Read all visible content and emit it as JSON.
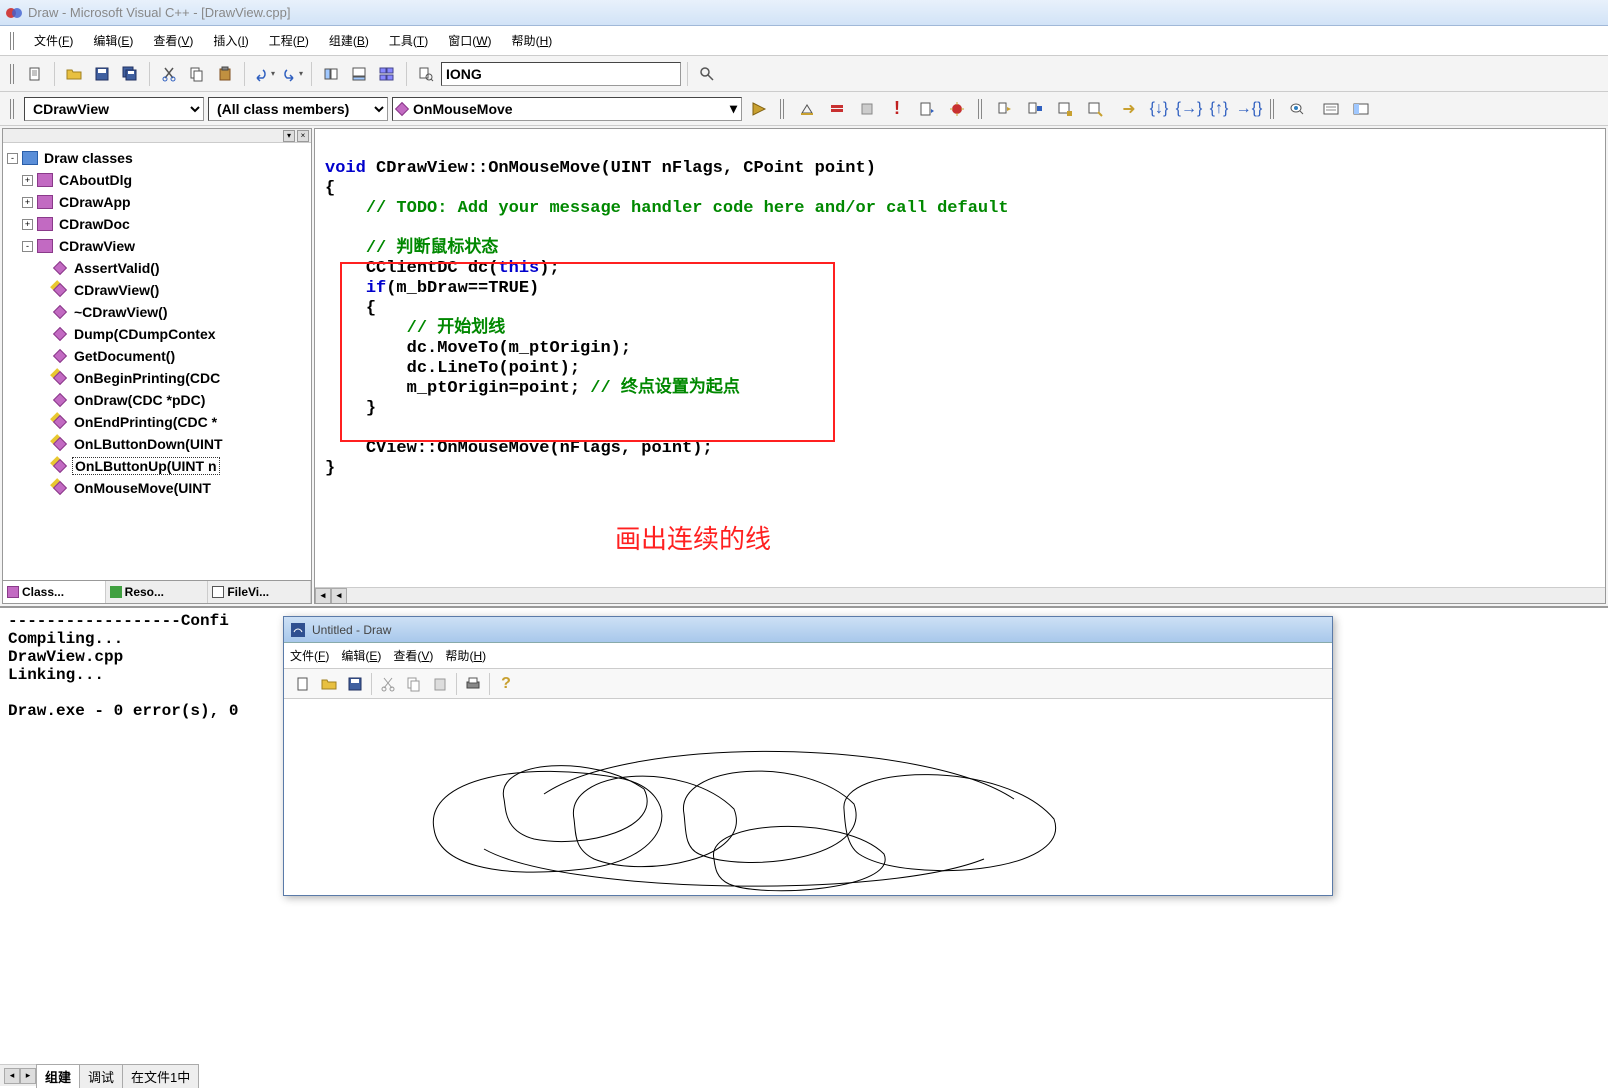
{
  "window": {
    "title": "Draw - Microsoft Visual C++ - [DrawView.cpp]"
  },
  "menubar": {
    "items": [
      {
        "label": "文件",
        "key": "F"
      },
      {
        "label": "编辑",
        "key": "E"
      },
      {
        "label": "查看",
        "key": "V"
      },
      {
        "label": "插入",
        "key": "I"
      },
      {
        "label": "工程",
        "key": "P"
      },
      {
        "label": "组建",
        "key": "B"
      },
      {
        "label": "工具",
        "key": "T"
      },
      {
        "label": "窗口",
        "key": "W"
      },
      {
        "label": "帮助",
        "key": "H"
      }
    ]
  },
  "toolbar": {
    "find_value": "IONG"
  },
  "navbar": {
    "class_combo": "CDrawView",
    "filter_combo": "(All class members)",
    "member_combo": "OnMouseMove"
  },
  "tree": {
    "root": "Draw classes",
    "classes": [
      {
        "label": "CAboutDlg",
        "expand": "+"
      },
      {
        "label": "CDrawApp",
        "expand": "+"
      },
      {
        "label": "CDrawDoc",
        "expand": "+"
      },
      {
        "label": "CDrawView",
        "expand": "-",
        "children": [
          {
            "label": "AssertValid()",
            "kind": "public"
          },
          {
            "label": "CDrawView()",
            "kind": "protected"
          },
          {
            "label": "~CDrawView()",
            "kind": "public"
          },
          {
            "label": "Dump(CDumpContex",
            "kind": "public"
          },
          {
            "label": "GetDocument()",
            "kind": "public"
          },
          {
            "label": "OnBeginPrinting(CDC",
            "kind": "protected"
          },
          {
            "label": "OnDraw(CDC *pDC)",
            "kind": "public"
          },
          {
            "label": "OnEndPrinting(CDC *",
            "kind": "protected"
          },
          {
            "label": "OnLButtonDown(UINT",
            "kind": "protected"
          },
          {
            "label": "OnLButtonUp(UINT n",
            "kind": "protected",
            "selected": true
          },
          {
            "label": "OnMouseMove(UINT",
            "kind": "protected"
          }
        ]
      }
    ]
  },
  "sidebar_tabs": {
    "items": [
      "Class...",
      "Reso...",
      "FileVi..."
    ]
  },
  "code": {
    "sig_pre": "void",
    "sig_rest": " CDrawView::OnMouseMove(UINT nFlags, CPoint point)",
    "comment_todo": "// TODO: Add your message handler code here and/or call default",
    "comment_mouse": "// 判断鼠标状态",
    "line_dc1": "CClientDC dc(",
    "line_dc_this": "this",
    "line_dc2": ");",
    "line_if_pre": "if",
    "line_if_rest": "(m_bDraw==TRUE)",
    "brace_open": "{",
    "comment_draw": "// 开始划线",
    "line_moveto": "dc.MoveTo(m_ptOrigin);",
    "line_lineto": "dc.LineTo(point);",
    "line_origin": "m_ptOrigin=point; ",
    "comment_endpoint": "// 终点设置为起点",
    "brace_close": "}",
    "line_base": "CView::OnMouseMove(nFlags, point);",
    "fn_close": "}"
  },
  "annotation": {
    "text": "画出连续的线"
  },
  "output": {
    "header": "------------------Confi",
    "l1": "Compiling...",
    "l2": "DrawView.cpp",
    "l3": "Linking...",
    "l5": "Draw.exe - 0 error(s), 0 ",
    "tabs": [
      "组建",
      "调试",
      "在文件1中"
    ]
  },
  "child": {
    "title": "Untitled - Draw",
    "menubar": [
      {
        "label": "文件",
        "key": "F"
      },
      {
        "label": "编辑",
        "key": "E"
      },
      {
        "label": "查看",
        "key": "V"
      },
      {
        "label": "帮助",
        "key": "H"
      }
    ]
  }
}
